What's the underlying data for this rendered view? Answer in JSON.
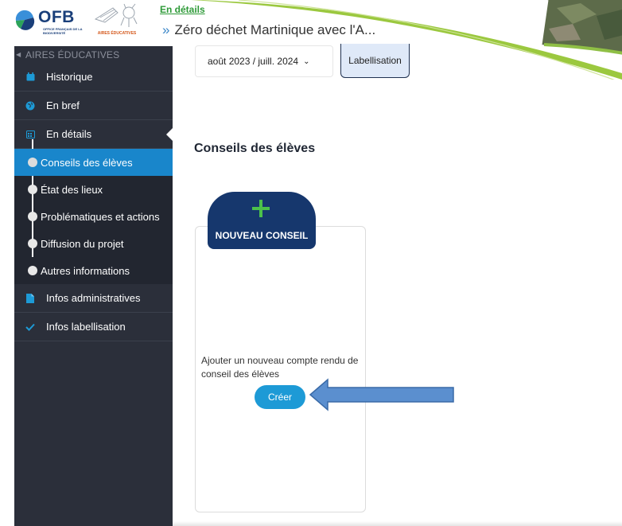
{
  "header": {
    "ofb_logo_text": "OFB",
    "ofb_logo_subtext": "OFFICE FRANÇAIS DE LA BIODIVERSITÉ",
    "aires_logo_text": "AIRES ÉDUCATIVES",
    "breadcrumb_link": "En détails",
    "page_title": "Zéro déchet Martinique avec l'A..."
  },
  "sidebar": {
    "section_title": "AIRES ÉDUCATIVES",
    "items": [
      {
        "label": "Historique",
        "icon": "calendar-icon"
      },
      {
        "label": "En bref",
        "icon": "globe-icon"
      },
      {
        "label": "En détails",
        "icon": "calendar-grid-icon"
      }
    ],
    "subitems": [
      {
        "label": "Conseils des élèves",
        "active": true
      },
      {
        "label": "État des lieux"
      },
      {
        "label": "Problématiques et actions"
      },
      {
        "label": "Diffusion du projet"
      },
      {
        "label": "Autres informations"
      }
    ],
    "items_after": [
      {
        "label": "Infos administratives",
        "icon": "document-icon"
      },
      {
        "label": "Infos labellisation",
        "icon": "check-icon"
      }
    ]
  },
  "main": {
    "period_select": "août 2023 / juill. 2024",
    "labellisation_button": "Labellisation",
    "section_title": "Conseils des élèves",
    "new_council_label": "NOUVEAU CONSEIL",
    "card_description": "Ajouter un nouveau compte rendu de conseil des élèves",
    "create_button": "Créer"
  },
  "colors": {
    "sidebar_bg": "#2b2f3a",
    "sidebar_active": "#1986cb",
    "accent_blue": "#1d9ad6",
    "navy": "#16376d",
    "green_link": "#2e9a38",
    "plus_green": "#4cc14a"
  }
}
